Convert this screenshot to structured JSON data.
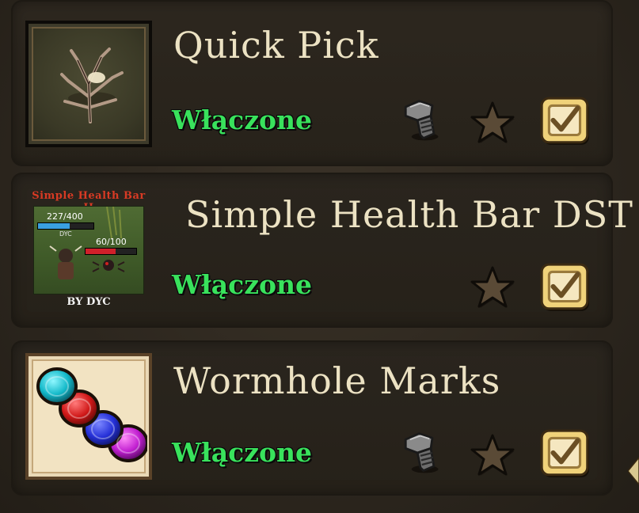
{
  "mods": [
    {
      "title": "Quick Pick",
      "status": "Włączone",
      "icons": [
        "server-bolt-icon",
        "favorite-star-icon",
        "enabled-checkbox-icon"
      ]
    },
    {
      "title": "Simple Health Bar DST",
      "status": "Włączone",
      "thumbnail": {
        "banner": "Simple Health Bar II",
        "player_hp": "227/400",
        "player_name": "DYC",
        "enemy_hp": "60/100",
        "byline": "BY DYC"
      },
      "player_fill": 0.57,
      "enemy_fill": 0.6,
      "icons": [
        "favorite-star-icon",
        "enabled-checkbox-icon"
      ]
    },
    {
      "title": "Wormhole Marks",
      "status": "Włączone",
      "icons": [
        "server-bolt-icon",
        "favorite-star-icon",
        "enabled-checkbox-icon"
      ]
    }
  ],
  "colors": {
    "status_green": "#39e25c",
    "title_cream": "#ece2c3",
    "checkbox_gold": "#e8c76a",
    "star_brown": "#5a4a36"
  }
}
